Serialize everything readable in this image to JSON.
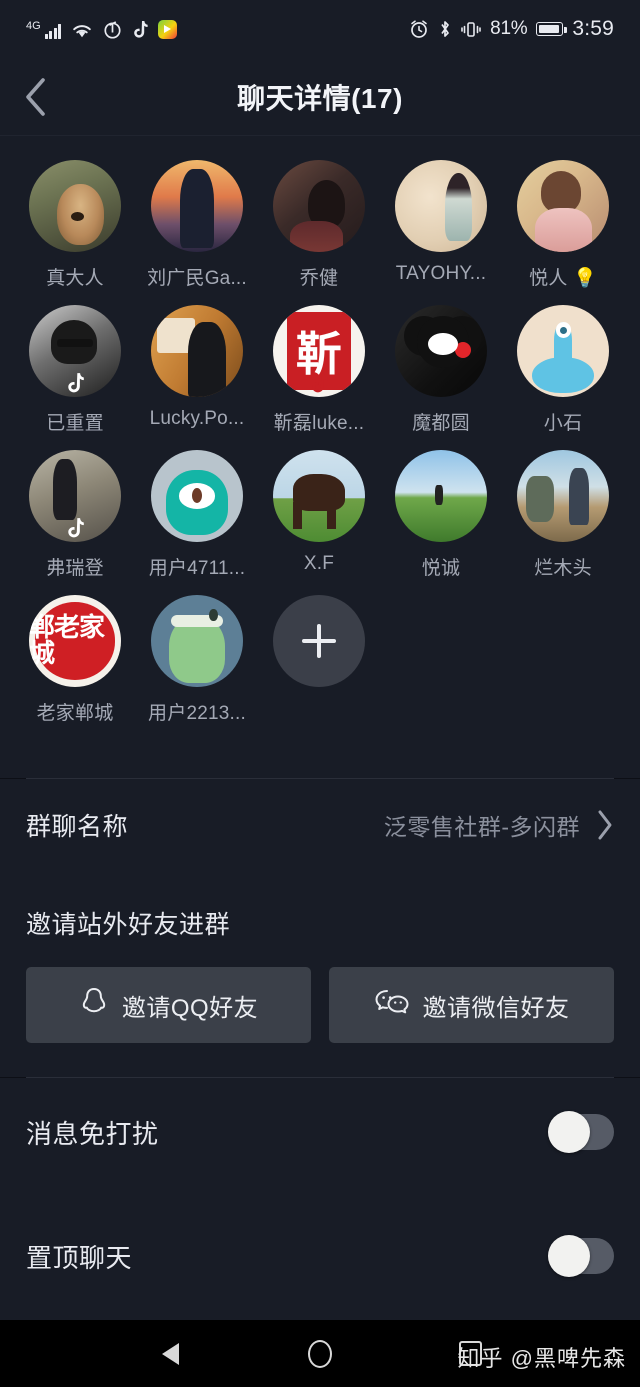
{
  "status_bar": {
    "network_type": "4G",
    "icons": [
      "signal-bars-icon",
      "wifi-icon",
      "netease-music-icon",
      "tiktok-icon",
      "app-icon"
    ],
    "alarm_icon": "alarm-clock-icon",
    "bluetooth_icon": "bluetooth-icon",
    "vibrate_icon": "vibrate-icon",
    "battery_percent": "81%",
    "time": "3:59"
  },
  "header": {
    "back_icon": "back-chevron-icon",
    "title": "聊天详情(17)"
  },
  "members": {
    "rows": [
      [
        {
          "name": "真大人",
          "avatar": "a-dog",
          "badge": false,
          "seal": ""
        },
        {
          "name": "刘广民Ga...",
          "avatar": "a-sunset",
          "badge": false,
          "seal": ""
        },
        {
          "name": "乔健",
          "avatar": "a-girl1",
          "badge": false,
          "seal": ""
        },
        {
          "name": "TAYOHY...",
          "avatar": "a-lady1",
          "badge": false,
          "seal": ""
        },
        {
          "name": "悦人 💡",
          "avatar": "a-lady2",
          "badge": false,
          "seal": ""
        }
      ],
      [
        {
          "name": "已重置",
          "avatar": "a-bw",
          "badge": true,
          "seal": ""
        },
        {
          "name": "Lucky.Po...",
          "avatar": "a-stage",
          "badge": true,
          "seal": ""
        },
        {
          "name": "靳磊luke...",
          "avatar": "a-seal1",
          "badge": true,
          "seal": "靳"
        },
        {
          "name": "魔都圆",
          "avatar": "a-kuma",
          "badge": false,
          "seal": ""
        },
        {
          "name": "小石",
          "avatar": "a-ufo",
          "badge": false,
          "seal": ""
        }
      ],
      [
        {
          "name": "弗瑞登",
          "avatar": "a-run",
          "badge": true,
          "seal": ""
        },
        {
          "name": "用户4711...",
          "avatar": "a-mon1",
          "badge": false,
          "seal": ""
        },
        {
          "name": "X.F",
          "avatar": "a-horse",
          "badge": false,
          "seal": ""
        },
        {
          "name": "悦诚",
          "avatar": "a-field",
          "badge": false,
          "seal": ""
        },
        {
          "name": "烂木头",
          "avatar": "a-beach",
          "badge": false,
          "seal": ""
        }
      ],
      [
        {
          "name": "老家郸城",
          "avatar": "a-seal2",
          "badge": false,
          "seal": "郸老家城"
        },
        {
          "name": "用户2213...",
          "avatar": "a-mon2",
          "badge": false,
          "seal": ""
        }
      ]
    ],
    "add_button_label": "+"
  },
  "group_name": {
    "label": "群聊名称",
    "value": "泛零售社群-多闪群",
    "chevron_icon": "chevron-right-icon"
  },
  "invite": {
    "title": "邀请站外好友进群",
    "qq_button": {
      "label": "邀请QQ好友",
      "icon": "qq-penguin-icon"
    },
    "wechat_button": {
      "label": "邀请微信好友",
      "icon": "wechat-icon"
    }
  },
  "toggles": [
    {
      "label": "消息免打扰",
      "state": "off"
    },
    {
      "label": "置顶聊天",
      "state": "off"
    }
  ],
  "nav_bar": {
    "back_icon": "nav-back-triangle-icon",
    "home_icon": "nav-home-circle-icon",
    "recents_icon": "nav-recents-square-icon"
  },
  "watermark": "知乎 @黑啤先森",
  "colors": {
    "background": "#181c26",
    "page_background": "#0d0f16",
    "text_primary": "#e8eaf0",
    "text_secondary": "#8b909d",
    "button_bg": "#3b4049",
    "switch_track": "#565b66",
    "switch_knob": "#f2f2f0"
  }
}
